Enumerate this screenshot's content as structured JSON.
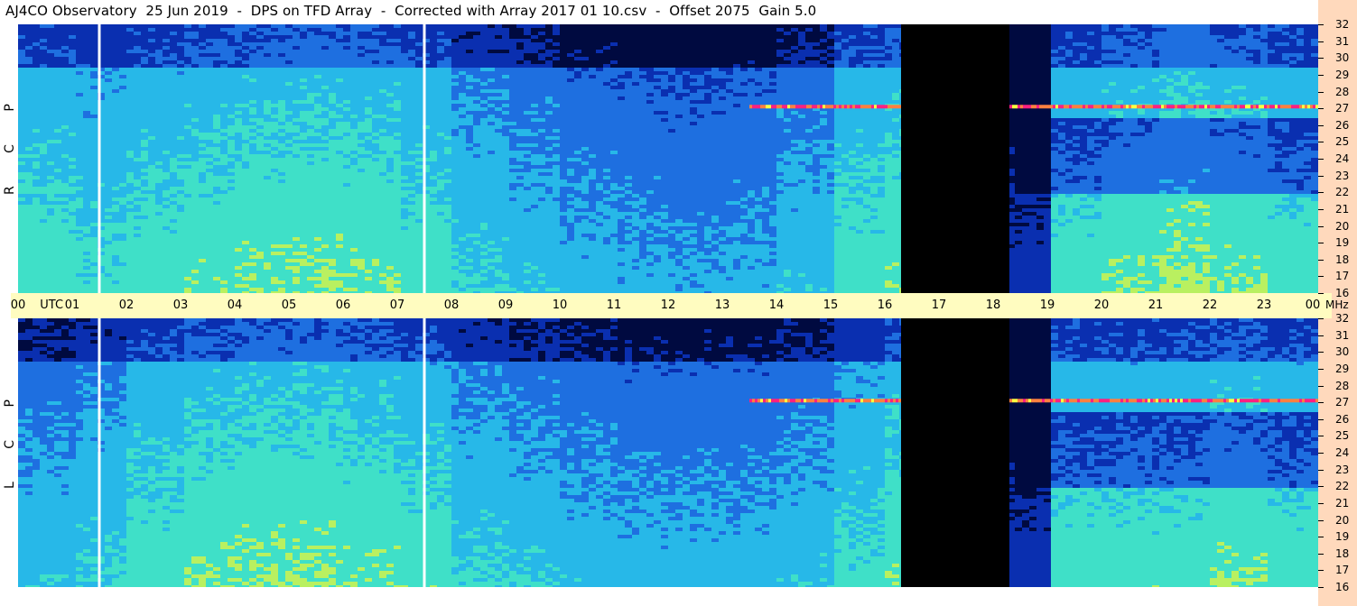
{
  "title": "AJ4CO Observatory  25 Jun 2019  -  DPS on TFD Array  -  Corrected with Array 2017 01 10.csv  -  Offset 2075  Gain 5.0",
  "time_axis": {
    "labels": [
      "00",
      "UTC",
      "01",
      "02",
      "03",
      "04",
      "05",
      "06",
      "07",
      "08",
      "09",
      "10",
      "11",
      "12",
      "13",
      "14",
      "15",
      "16",
      "17",
      "18",
      "19",
      "20",
      "21",
      "22",
      "23",
      "00"
    ],
    "unit": "MHz"
  },
  "panels": [
    {
      "id": "rcp",
      "label": "R C P"
    },
    {
      "id": "lcp",
      "label": "L C P"
    }
  ],
  "chart_data": {
    "type": "heatmap",
    "title": "AJ4CO Observatory  25 Jun 2019  -  DPS on TFD Array  -  Corrected with Array 2017 01 10.csv  -  Offset 2075  Gain 5.0",
    "x_unit": "UTC hour",
    "xlim": [
      0,
      24
    ],
    "y_unit": "MHz",
    "ylim": [
      16,
      32
    ],
    "y_ticks": [
      16,
      17,
      18,
      19,
      20,
      21,
      22,
      23,
      24,
      25,
      26,
      27,
      28,
      29,
      30,
      31,
      32
    ],
    "x_ticks": [
      0,
      1,
      2,
      3,
      4,
      5,
      6,
      7,
      8,
      9,
      10,
      11,
      12,
      13,
      14,
      15,
      16,
      17,
      18,
      19,
      20,
      21,
      22,
      23,
      24
    ],
    "data_gap_hours": [
      16.3,
      18.3
    ],
    "marker_lines_hours": [
      1.5,
      7.5
    ],
    "strong_band_mhz": 27.1,
    "colormap": [
      "#000a40",
      "#0a2fb0",
      "#1e6fe0",
      "#27b8e8",
      "#3fe0c8",
      "#b9f060",
      "#ffff40",
      "#ff8040",
      "#ff2080",
      "#ffffff"
    ],
    "series": [
      {
        "name": "R C P",
        "intensity_profile_by_hour": [
          0.55,
          0.5,
          0.55,
          0.58,
          0.6,
          0.62,
          0.6,
          0.55,
          0.45,
          0.4,
          0.35,
          0.32,
          0.3,
          0.32,
          0.4,
          0.55,
          0.6,
          0,
          0,
          0.55,
          0.6,
          0.65,
          0.6,
          0.55,
          0.5
        ]
      },
      {
        "name": "L C P",
        "intensity_profile_by_hour": [
          0.4,
          0.45,
          0.55,
          0.6,
          0.62,
          0.62,
          0.6,
          0.55,
          0.45,
          0.42,
          0.38,
          0.35,
          0.35,
          0.35,
          0.4,
          0.5,
          0.58,
          0,
          0,
          0.55,
          0.55,
          0.55,
          0.6,
          0.55,
          0.5
        ]
      }
    ]
  }
}
